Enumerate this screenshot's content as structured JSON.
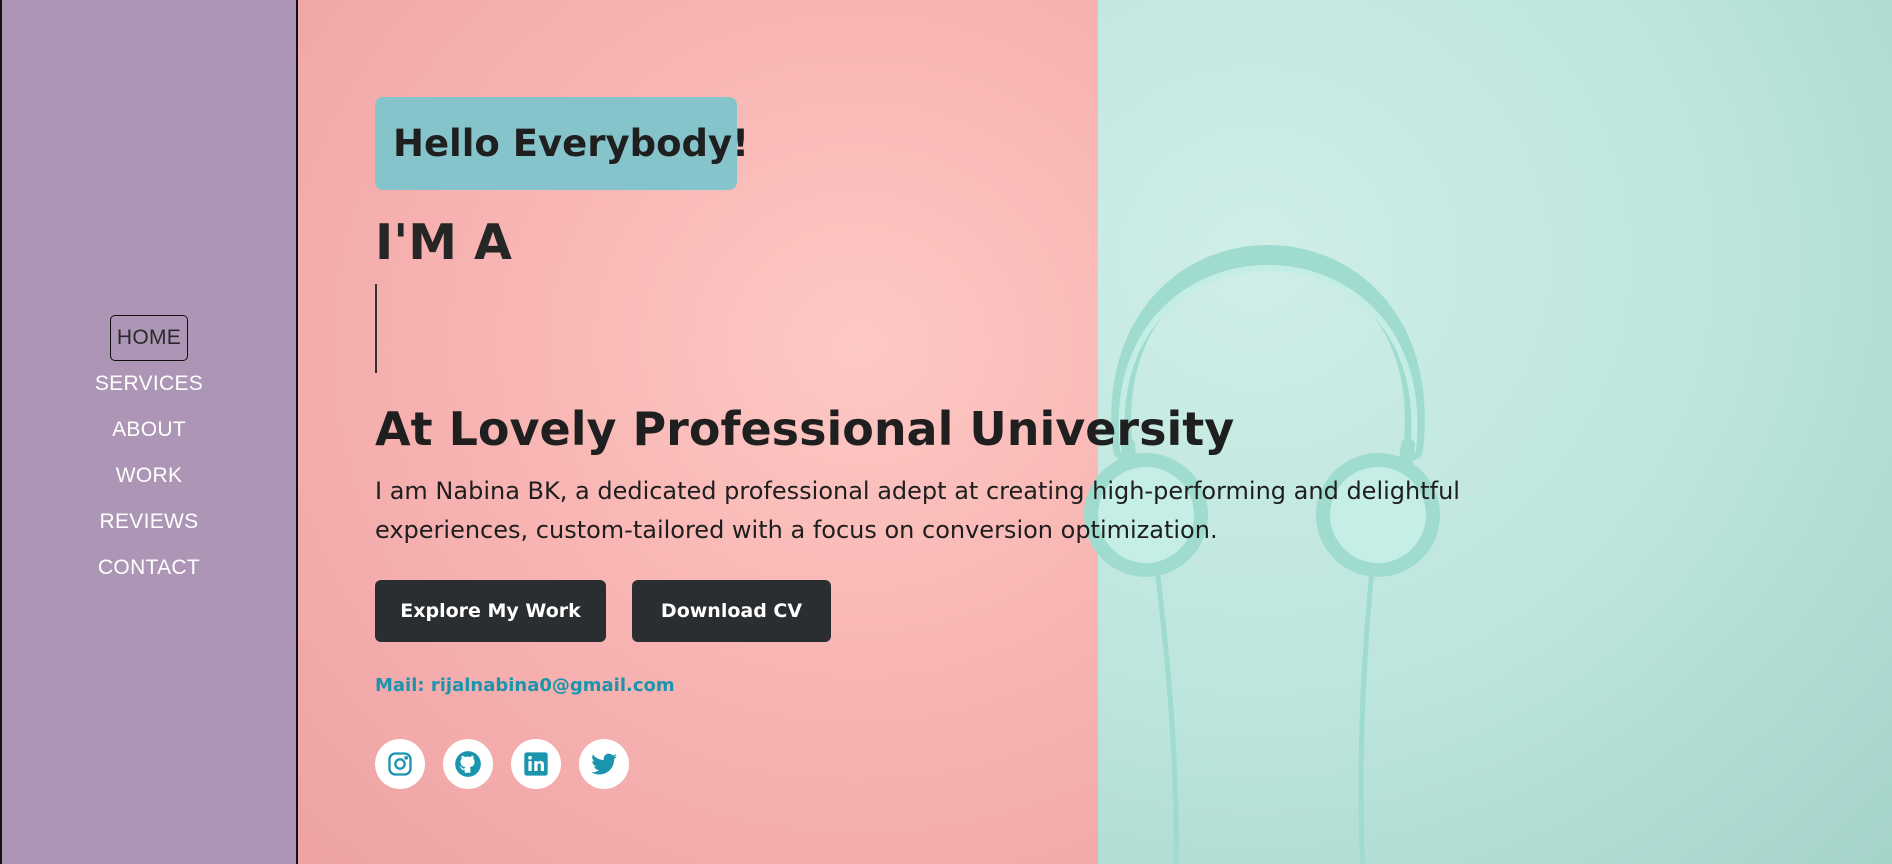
{
  "nav": {
    "items": [
      {
        "label": "HOME",
        "active": true
      },
      {
        "label": "SERVICES"
      },
      {
        "label": "ABOUT"
      },
      {
        "label": "WORK"
      },
      {
        "label": "REVIEWS"
      },
      {
        "label": "CONTACT"
      }
    ]
  },
  "hero": {
    "greeting": "Hello Everybody!",
    "intro": "I'M A",
    "university": "At Lovely Professional University",
    "description": "I am Nabina BK, a dedicated professional adept at creating high-performing and delightful experiences, custom-tailored with a focus on conversion optimization.",
    "buttons": {
      "explore": "Explore My Work",
      "download": "Download CV"
    },
    "mail": "Mail: rijalnabina0@gmail.com",
    "socials": [
      "instagram-icon",
      "github-icon",
      "linkedin-icon",
      "twitter-icon"
    ]
  },
  "colors": {
    "sidebar": "#ad96b5",
    "greeting_bg": "#86c4cb",
    "button_bg": "#2a2e30",
    "mail": "#1b95ad",
    "icon": "#1b95ad"
  }
}
